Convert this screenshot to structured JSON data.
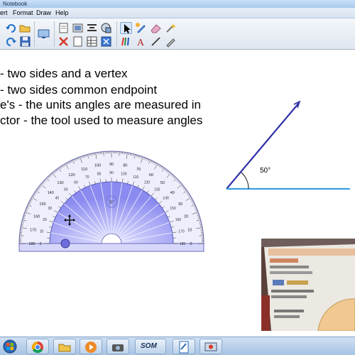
{
  "window": {
    "title": "Notebook"
  },
  "menu": [
    "ert",
    "Format",
    "Draw",
    "Help"
  ],
  "toolbar": {
    "tools": [
      {
        "icon": "undo-icon"
      },
      {
        "icon": "redo-icon"
      },
      {
        "icon": "open-folder-icon"
      },
      {
        "icon": "save-icon"
      },
      {
        "icon": "screen-shade-icon"
      },
      {
        "icon": "insert-page-icon"
      },
      {
        "icon": "screen-capture-icon"
      },
      {
        "icon": "delete-icon"
      },
      {
        "icon": "insert-table-icon"
      },
      {
        "icon": "full-screen-icon"
      },
      {
        "icon": "shapes-icon"
      },
      {
        "icon": "select-pointer-icon"
      },
      {
        "icon": "pen-icon"
      },
      {
        "icon": "eraser-icon"
      },
      {
        "icon": "magic-pen-icon"
      },
      {
        "icon": "creative-pen-icon"
      },
      {
        "icon": "text-tool-icon"
      },
      {
        "icon": "line-tool-icon"
      },
      {
        "icon": "fill-tool-icon"
      }
    ]
  },
  "notes": {
    "lines": [
      "- two sides and a vertex",
      "- two sides common endpoint",
      "e's - the units angles are measured in",
      "ctor - the tool used to measure angles"
    ]
  },
  "angle": {
    "label": "50°",
    "degrees": 50,
    "color": "#3333aa"
  },
  "protractor": {
    "outer_labels": [
      "180",
      "170",
      "160",
      "150",
      "140",
      "130",
      "120",
      "110",
      "100",
      "90",
      "80",
      "70",
      "60",
      "50",
      "40",
      "30",
      "20",
      "10",
      "0"
    ],
    "inner_labels": [
      "0",
      "10",
      "20",
      "30",
      "40",
      "50",
      "60",
      "70",
      "80",
      "90",
      "100",
      "110",
      "120",
      "130",
      "140",
      "150",
      "160",
      "170",
      "180"
    ],
    "fill_color": "#8e8ef0"
  },
  "taskbar": {
    "apps": [
      {
        "icon": "start-orb-icon"
      },
      {
        "icon": "chrome-icon"
      },
      {
        "icon": "file-explorer-icon"
      },
      {
        "icon": "media-player-icon"
      },
      {
        "icon": "camera-app-icon"
      },
      {
        "icon": "som-app-icon"
      },
      {
        "icon": "notebook-app-icon"
      },
      {
        "icon": "screen-recorder-icon"
      },
      {
        "icon": "settings-app-icon"
      }
    ],
    "som_label": "SOM"
  }
}
